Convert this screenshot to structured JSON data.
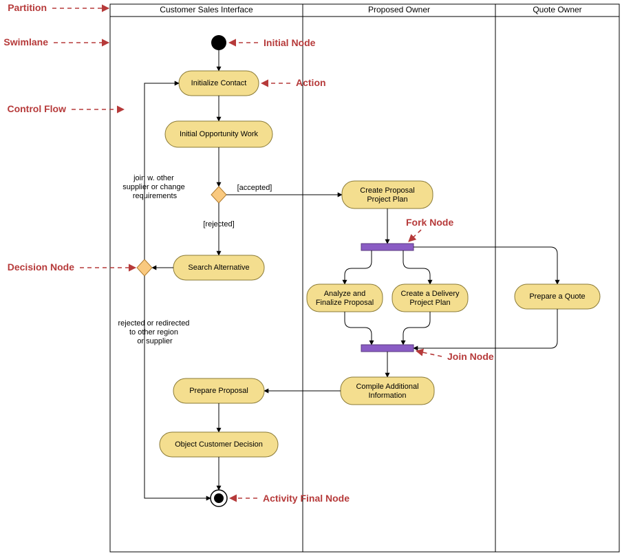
{
  "diagram_type": "UML Activity Diagram with Swimlanes",
  "annotations": {
    "partition": "Partition",
    "swimlane": "Swimlane",
    "control_flow": "Control Flow",
    "decision_node": "Decision Node",
    "initial_node": "Initial Node",
    "action": "Action",
    "fork_node": "Fork Node",
    "join_node": "Join Node",
    "activity_final_node": "Activity Final Node"
  },
  "swimlanes": {
    "lane1": "Customer Sales Interface",
    "lane2": "Proposed Owner",
    "lane3": "Quote Owner"
  },
  "actions": {
    "initialize_contact": "Initialize Contact",
    "initial_opportunity_work": "Initial Opportunity Work",
    "search_alternative": "Search Alternative",
    "create_proposal_project_plan_l1": "Create Proposal",
    "create_proposal_project_plan_l2": "Project Plan",
    "analyze_finalize_l1": "Analyze and",
    "analyze_finalize_l2": "Finalize Proposal",
    "create_delivery_l1": "Create a Delivery",
    "create_delivery_l2": "Project Plan",
    "prepare_quote": "Prepare a Quote",
    "compile_additional_l1": "Compile Additional",
    "compile_additional_l2": "Information",
    "prepare_proposal": "Prepare Proposal",
    "object_customer_decision": "Object Customer Decision"
  },
  "edge_labels": {
    "accepted": "[accepted]",
    "rejected": "[rejected]",
    "join_other_l1": "join w. other",
    "join_other_l2": "supplier or change",
    "join_other_l3": "requirements",
    "rejected_redirect_l1": "rejected or redirected",
    "rejected_redirect_l2": "to other region",
    "rejected_redirect_l3": "or supplier"
  },
  "colors": {
    "action_fill": "#f4de8f",
    "action_stroke": "#8a7a36",
    "decision_fill": "#f9c97f",
    "decision_stroke": "#b07b2e",
    "bar_fill": "#8a5cc4",
    "annotation": "#b63a3a",
    "lane_stroke": "#000000"
  }
}
